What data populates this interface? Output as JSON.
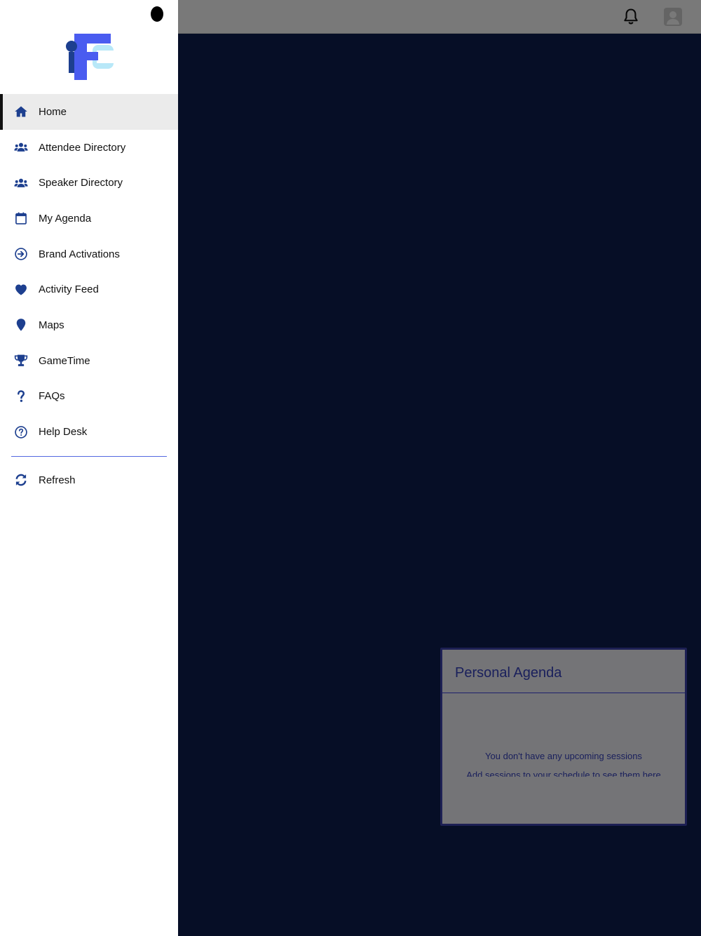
{
  "colors": {
    "brand": "#1d3f8f",
    "drawer_bg": "#ffffff",
    "active_bg": "#ebebeb",
    "content_bg": "#0c1d4c",
    "card_accent": "#3540b8"
  },
  "topbar": {
    "bell_icon": "bell-icon",
    "avatar_icon": "user-avatar-icon"
  },
  "drawer": {
    "logo": "FC",
    "items": [
      {
        "label": "Home",
        "icon": "home-icon",
        "active": true
      },
      {
        "label": "Attendee Directory",
        "icon": "users-icon"
      },
      {
        "label": "Speaker Directory",
        "icon": "users-icon"
      },
      {
        "label": "My Agenda",
        "icon": "calendar-icon"
      },
      {
        "label": "Brand Activations",
        "icon": "arrow-circle-right-icon"
      },
      {
        "label": "Activity Feed",
        "icon": "heart-icon"
      },
      {
        "label": "Maps",
        "icon": "map-pin-icon"
      },
      {
        "label": "GameTime",
        "icon": "trophy-icon"
      },
      {
        "label": "FAQs",
        "icon": "question-icon"
      },
      {
        "label": "Help Desk",
        "icon": "question-circle-icon"
      }
    ],
    "refresh": {
      "label": "Refresh",
      "icon": "refresh-icon"
    }
  },
  "agenda_card": {
    "title": "Personal Agenda",
    "empty_message": "You don't have any upcoming sessions",
    "hint": "Add sessions to your schedule to see them here"
  }
}
